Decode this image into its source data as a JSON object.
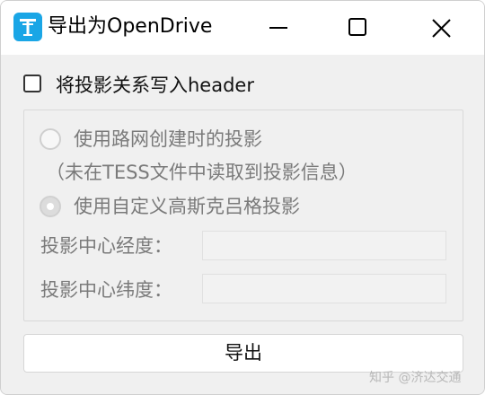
{
  "window": {
    "title": "导出为OpenDrive",
    "icon": "app-logo-icon",
    "controls": {
      "minimize_icon": "minimize-icon",
      "maximize_icon": "maximize-icon",
      "close_icon": "close-icon"
    }
  },
  "dialog": {
    "header_checkbox_label": "将投影关系写入header",
    "header_checkbox_checked": false,
    "projection_group": {
      "option_network_label": "使用路网创建时的投影",
      "option_network_note": "（未在TESS文件中读取到投影信息）",
      "option_custom_label": "使用自定义高斯克吕格投影",
      "selected": "option_custom",
      "enabled": false,
      "longitude_label": "投影中心经度：",
      "longitude_value": "",
      "latitude_label": "投影中心纬度：",
      "latitude_value": ""
    },
    "export_button_label": "导出"
  },
  "watermark": "知乎 @济达交通",
  "colors": {
    "accent": "#1aa6e6",
    "background": "#f0f0f0",
    "disabled_text": "#7a7a7a"
  }
}
